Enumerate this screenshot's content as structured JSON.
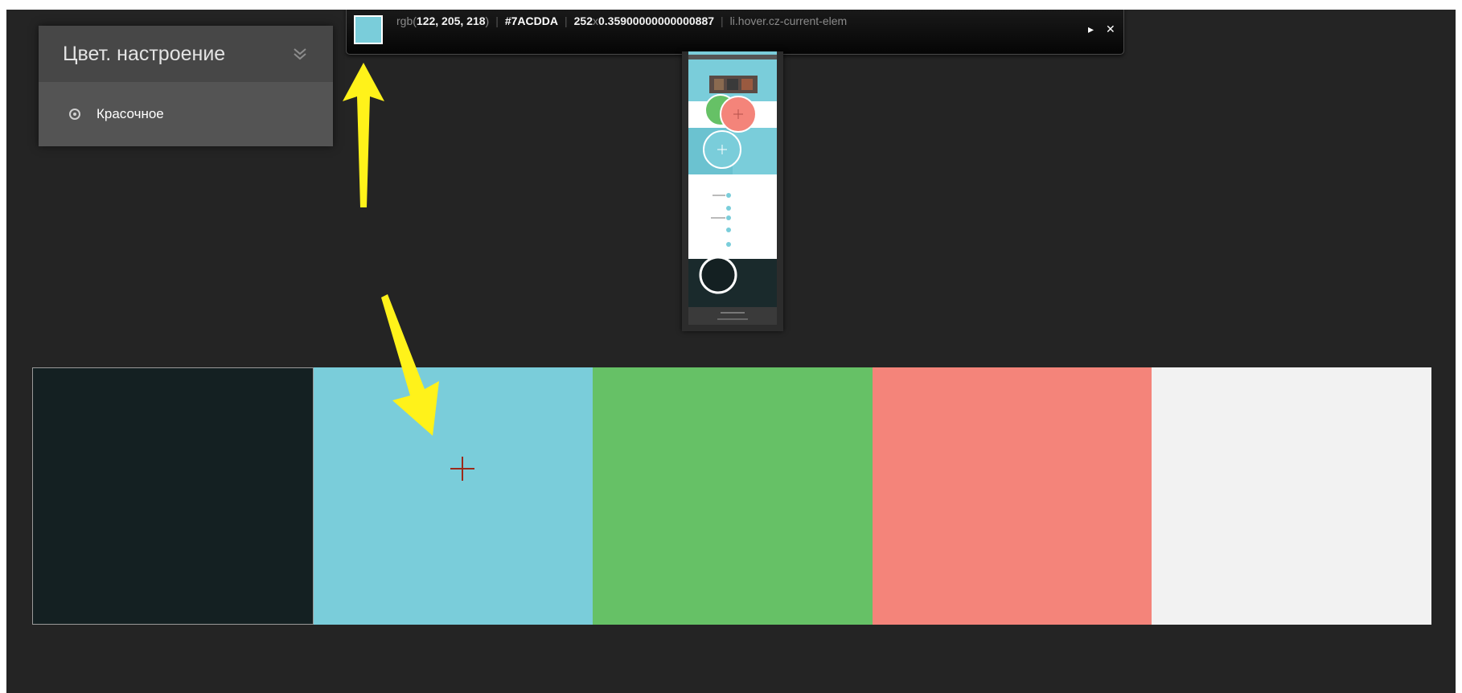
{
  "mood_panel": {
    "title": "Цвет. настроение",
    "option_label": "Красочное",
    "icons": {
      "toggle": "double-chevron-down-icon",
      "option": "radio-icon"
    }
  },
  "picker": {
    "rgb_prefix": "rgb(",
    "rgb_values": "122, 205, 218",
    "rgb_suffix": ")",
    "hex": "#7ACDDA",
    "width": "252",
    "times": "x",
    "height": "0.35900000000000887",
    "selector": "li.hover.cz-current-elem",
    "swatch_color": "#7ACDDA",
    "icons": {
      "play": "play-icon",
      "close": "close-icon"
    },
    "play_glyph": "▸",
    "close_glyph": "✕"
  },
  "palette": {
    "colors": [
      "#142022",
      "#7ACDDA",
      "#66C166",
      "#F4847A",
      "#F2F2F2"
    ],
    "selected_index": 0
  },
  "annotation": {
    "arrow_color": "#FFF21A",
    "crosshair_color": "#9B2A1A"
  }
}
